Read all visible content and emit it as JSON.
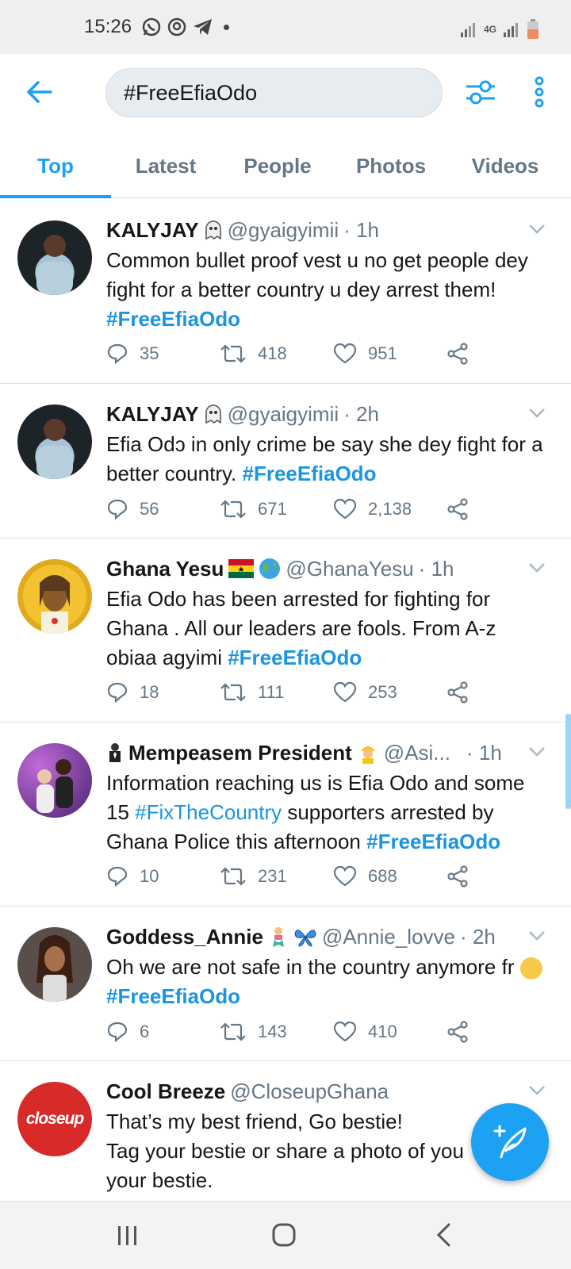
{
  "status": {
    "time": "15:26",
    "network": "4G"
  },
  "search": {
    "query": "#FreeEfiaOdo"
  },
  "tabs": [
    "Top",
    "Latest",
    "People",
    "Photos",
    "Videos"
  ],
  "active_tab": "Top",
  "tweets": [
    {
      "name": "KALYJAY",
      "handle": "@gyaigyimii",
      "time": "· 1h",
      "text": "Common bullet proof vest u no get people dey fight for a better country u dey arrest them! ",
      "hashtag": "#FreeEfiaOdo",
      "replies": "35",
      "retweets": "418",
      "likes": "951"
    },
    {
      "name": "KALYJAY",
      "handle": "@gyaigyimii",
      "time": "· 2h",
      "text": "Efia Odɔ in only crime be say she dey fight for a better country. ",
      "hashtag": "#FreeEfiaOdo",
      "replies": "56",
      "retweets": "671",
      "likes": "2,138"
    },
    {
      "name": "Ghana Yesu",
      "handle": "@GhanaYesu",
      "time": "· 1h",
      "text": "Efia Odo has been arrested for fighting for Ghana . All our leaders are fools. From A-z obiaa agyimi ",
      "hashtag": "#FreeEfiaOdo",
      "replies": "18",
      "retweets": "111",
      "likes": "253"
    },
    {
      "name": "Mempeasem President",
      "handle": "@Asi...",
      "time": "· 1h",
      "text_a": "Information reaching us is Efia Odo and some 15 ",
      "tag_a": "#FixTheCountry",
      "text_b": " supporters arrested by Ghana Police this afternoon  ",
      "hashtag": "#FreeEfiaOdo",
      "replies": "10",
      "retweets": "231",
      "likes": "688"
    },
    {
      "name": "Goddess_Annie",
      "handle": "@Annie_lovve",
      "time": "· 2h",
      "text": "Oh we are not safe in the country anymore fr ",
      "hashtag": "#FreeEfiaOdo",
      "replies": "6",
      "retweets": "143",
      "likes": "410"
    },
    {
      "name": "Cool Breeze",
      "handle": "@CloseupGhana",
      "text_l1": "That’s my best friend, Go bestie!",
      "text_l2": "Tag your bestie or share a photo of you",
      "text_l3": "your bestie.",
      "avatar_text": "closeup"
    }
  ],
  "colors": {
    "accent": "#1da1f2",
    "hashtag": "#1b95e0",
    "muted": "#657786"
  }
}
